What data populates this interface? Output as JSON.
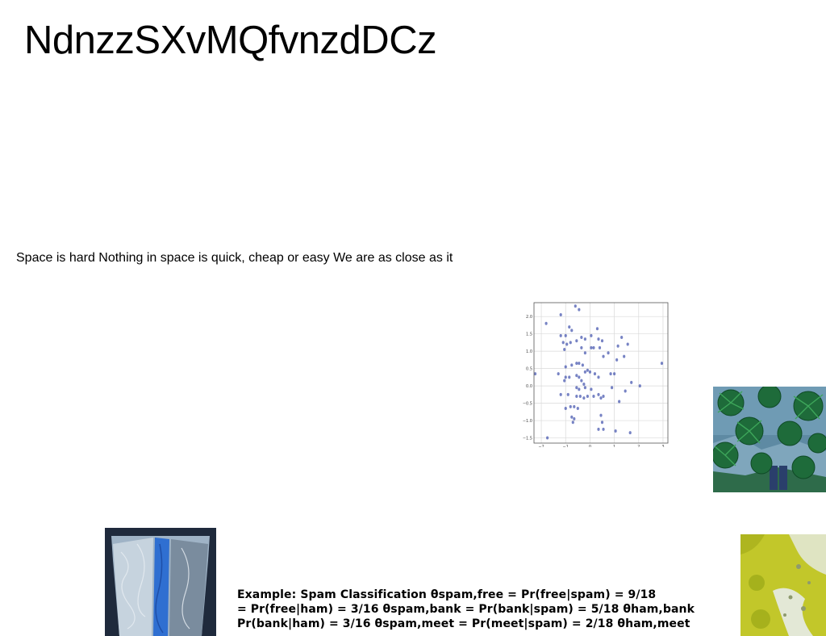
{
  "title": "NdnzzSXvMQfvnzdDCz",
  "subtitle": "Space is hard Nothing in space is quick, cheap or easy We are as close as it",
  "example_lines": [
    "Example: Spam Classification θspam,free = Pr(free|spam) = 9/18",
    "= Pr(free|ham) = 3/16 θspam,bank = Pr(bank|spam) = 5/18 θham,bank",
    "Pr(bank|ham) = 3/16 θspam,meet = Pr(meet|spam) = 2/18 θham,meet"
  ],
  "chart_data": {
    "type": "scatter",
    "xlim": [
      -2.3,
      3.2
    ],
    "ylim": [
      -1.65,
      2.4
    ],
    "xticks": [
      "−2",
      "−1",
      "0",
      "1",
      "2",
      "3"
    ],
    "yticks": [
      "2.0",
      "1.5",
      "1.0",
      "0.5",
      "0.0",
      "−0.5",
      "−1.0",
      "−1.5"
    ],
    "grid": true,
    "color": "#4a5ab0",
    "points": [
      [
        -1.8,
        1.8
      ],
      [
        -1.2,
        2.05
      ],
      [
        -0.6,
        2.3
      ],
      [
        -0.45,
        2.2
      ],
      [
        -0.85,
        1.7
      ],
      [
        -0.75,
        1.6
      ],
      [
        -1.2,
        1.45
      ],
      [
        -1.0,
        1.45
      ],
      [
        -1.1,
        1.25
      ],
      [
        -0.95,
        1.2
      ],
      [
        -0.8,
        1.25
      ],
      [
        -0.55,
        1.3
      ],
      [
        -0.35,
        1.4
      ],
      [
        -0.2,
        1.35
      ],
      [
        0.05,
        1.45
      ],
      [
        0.3,
        1.65
      ],
      [
        0.35,
        1.35
      ],
      [
        0.5,
        1.3
      ],
      [
        1.3,
        1.4
      ],
      [
        1.55,
        1.2
      ],
      [
        1.15,
        1.15
      ],
      [
        0.4,
        1.1
      ],
      [
        0.15,
        1.1
      ],
      [
        0.05,
        1.1
      ],
      [
        -1.05,
        1.05
      ],
      [
        -0.35,
        1.1
      ],
      [
        -0.2,
        0.95
      ],
      [
        0.55,
        0.85
      ],
      [
        0.75,
        0.95
      ],
      [
        1.4,
        0.85
      ],
      [
        1.1,
        0.75
      ],
      [
        -1.0,
        0.55
      ],
      [
        -0.75,
        0.6
      ],
      [
        -0.55,
        0.65
      ],
      [
        -0.45,
        0.65
      ],
      [
        -0.3,
        0.6
      ],
      [
        -2.25,
        0.35
      ],
      [
        -1.3,
        0.35
      ],
      [
        -1.0,
        0.25
      ],
      [
        -0.85,
        0.25
      ],
      [
        -1.05,
        0.15
      ],
      [
        -0.55,
        0.3
      ],
      [
        -0.45,
        0.25
      ],
      [
        -0.35,
        0.15
      ],
      [
        -0.2,
        0.4
      ],
      [
        -0.1,
        0.45
      ],
      [
        0.0,
        0.4
      ],
      [
        0.2,
        0.35
      ],
      [
        0.35,
        0.25
      ],
      [
        0.85,
        0.35
      ],
      [
        1.0,
        0.35
      ],
      [
        1.7,
        0.1
      ],
      [
        2.05,
        0.0
      ],
      [
        2.95,
        0.65
      ],
      [
        -0.55,
        -0.05
      ],
      [
        -0.45,
        -0.1
      ],
      [
        -0.25,
        0.05
      ],
      [
        -0.2,
        -0.05
      ],
      [
        0.05,
        -0.1
      ],
      [
        0.35,
        -0.25
      ],
      [
        0.55,
        -0.3
      ],
      [
        0.9,
        -0.05
      ],
      [
        1.45,
        -0.15
      ],
      [
        1.2,
        -0.45
      ],
      [
        -1.2,
        -0.25
      ],
      [
        -0.9,
        -0.25
      ],
      [
        -0.55,
        -0.3
      ],
      [
        -0.4,
        -0.3
      ],
      [
        -0.25,
        -0.35
      ],
      [
        -0.1,
        -0.3
      ],
      [
        0.15,
        -0.3
      ],
      [
        0.45,
        -0.35
      ],
      [
        -0.8,
        -0.6
      ],
      [
        -0.65,
        -0.6
      ],
      [
        -0.5,
        -0.65
      ],
      [
        -0.75,
        -0.9
      ],
      [
        -0.65,
        -0.95
      ],
      [
        -0.7,
        -1.05
      ],
      [
        0.45,
        -0.85
      ],
      [
        0.5,
        -1.05
      ],
      [
        0.35,
        -1.25
      ],
      [
        0.55,
        -1.25
      ],
      [
        1.05,
        -1.3
      ],
      [
        1.65,
        -1.35
      ],
      [
        -1.75,
        -1.5
      ],
      [
        -1.0,
        -0.65
      ]
    ]
  }
}
